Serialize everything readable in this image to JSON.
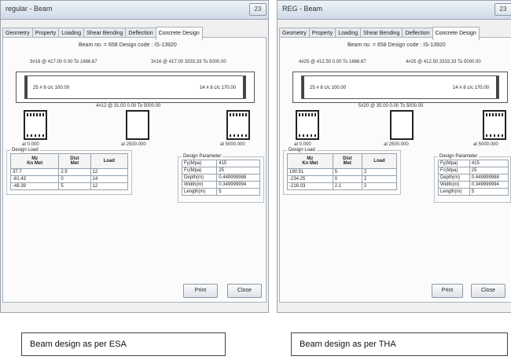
{
  "left_window": {
    "title": "regular - Beam",
    "control": "23",
    "tabs": [
      "Geometry",
      "Property",
      "Loading",
      "Shear Bending",
      "Deflection",
      "Concrete Design"
    ],
    "header": "Beam no. = 658  Design code : IS-13920",
    "top_left_bar": "3#16 @ 417.00 0.00 To 1666.67",
    "top_right_bar": "3#16 @ 417.00 3333.33 To 5000.00",
    "beam_left_label": "25 # 8 c/c 100.00",
    "beam_right_label": "14 # 8 c/c 170.00",
    "bottom_bar": "4#12 @ 31.00 0.00 To 5000.00",
    "section_labels": [
      "at 0.000",
      "at 2500.000",
      "at 5000.000"
    ],
    "design_load": {
      "legend": "Design Load",
      "headers": [
        "Mz\nKn Met",
        "Dist\nMet",
        "Load"
      ],
      "rows": [
        [
          "37.7",
          "2.5",
          "12"
        ],
        [
          "-81.43",
          "0",
          "14"
        ],
        [
          "-48.39",
          "5",
          "12"
        ]
      ]
    },
    "design_parameter": {
      "legend": "Design Parameter",
      "rows": [
        [
          "Fy(Mpa)",
          "415"
        ],
        [
          "Fc(Mpa)",
          "25"
        ],
        [
          "Depth(m)",
          "0.449999988"
        ],
        [
          "Width(m)",
          "0.349999994"
        ],
        [
          "Length(m)",
          "5"
        ]
      ]
    },
    "print_label": "Print",
    "close_label": "Close"
  },
  "right_window": {
    "title": "REG - Beam",
    "control": "23",
    "tabs": [
      "Geometry",
      "Property",
      "Loading",
      "Shear Bending",
      "Deflection",
      "Concrete Design"
    ],
    "header": "Beam no. = 658  Design code : IS-13920",
    "top_left_bar": "4#25 @ 412.50 0.00 To 1666.67",
    "top_right_bar": "4#25 @ 412.50 3333.33 To 5000.00",
    "beam_left_label": "25 # 8 c/c 100.00",
    "beam_right_label": "14 # 8 c/c 170.00",
    "bottom_bar": "5#20 @ 35.00 0.00 To 5000.00",
    "section_labels": [
      "at 0.000",
      "at 2500.000",
      "at 5000.000"
    ],
    "design_load": {
      "legend": "Design Load",
      "headers": [
        "Mz\nKn Met",
        "Dist\nMet",
        "Load"
      ],
      "rows": [
        [
          "190.51",
          "5",
          "2"
        ],
        [
          "-234.25",
          "0",
          "2"
        ],
        [
          "-216.03",
          "2.1",
          "2"
        ]
      ]
    },
    "design_parameter": {
      "legend": "Design Parameter",
      "rows": [
        [
          "Fy(Mpa)",
          "415"
        ],
        [
          "Fc(Mpa)",
          "25"
        ],
        [
          "Depth(m)",
          "0.449999988"
        ],
        [
          "Width(m)",
          "0.349999994"
        ],
        [
          "Length(m)",
          "5"
        ]
      ]
    },
    "print_label": "Print",
    "close_label": "Close"
  },
  "captions": {
    "left": "Beam design as per ESA",
    "right": "Beam design as per THA"
  }
}
